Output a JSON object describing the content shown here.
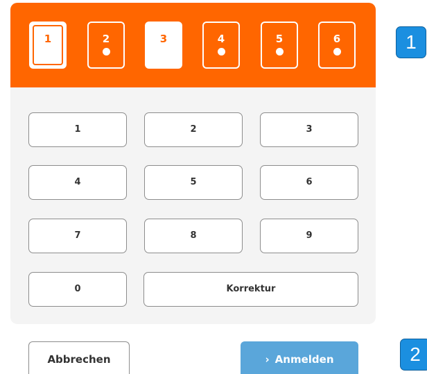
{
  "pin_indicator": {
    "digits": [
      {
        "label": "1",
        "state": "done",
        "filled": false
      },
      {
        "label": "2",
        "state": "filled",
        "filled": true
      },
      {
        "label": "3",
        "state": "active",
        "filled": false
      },
      {
        "label": "4",
        "state": "filled",
        "filled": true
      },
      {
        "label": "5",
        "state": "filled",
        "filled": true
      },
      {
        "label": "6",
        "state": "filled",
        "filled": true
      }
    ]
  },
  "keypad": {
    "keys": [
      "1",
      "2",
      "3",
      "4",
      "5",
      "6",
      "7",
      "8",
      "9",
      "0"
    ],
    "correction_label": "Korrektur"
  },
  "actions": {
    "cancel_label": "Abbrechen",
    "login_chevron": "›",
    "login_label": "Anmelden"
  },
  "markers": [
    "1",
    "2"
  ],
  "colors": {
    "brand_orange": "#ff6600",
    "login_blue": "#5aa6da",
    "marker_blue": "#1b8fe0",
    "panel_bg": "#f4f4f4"
  }
}
